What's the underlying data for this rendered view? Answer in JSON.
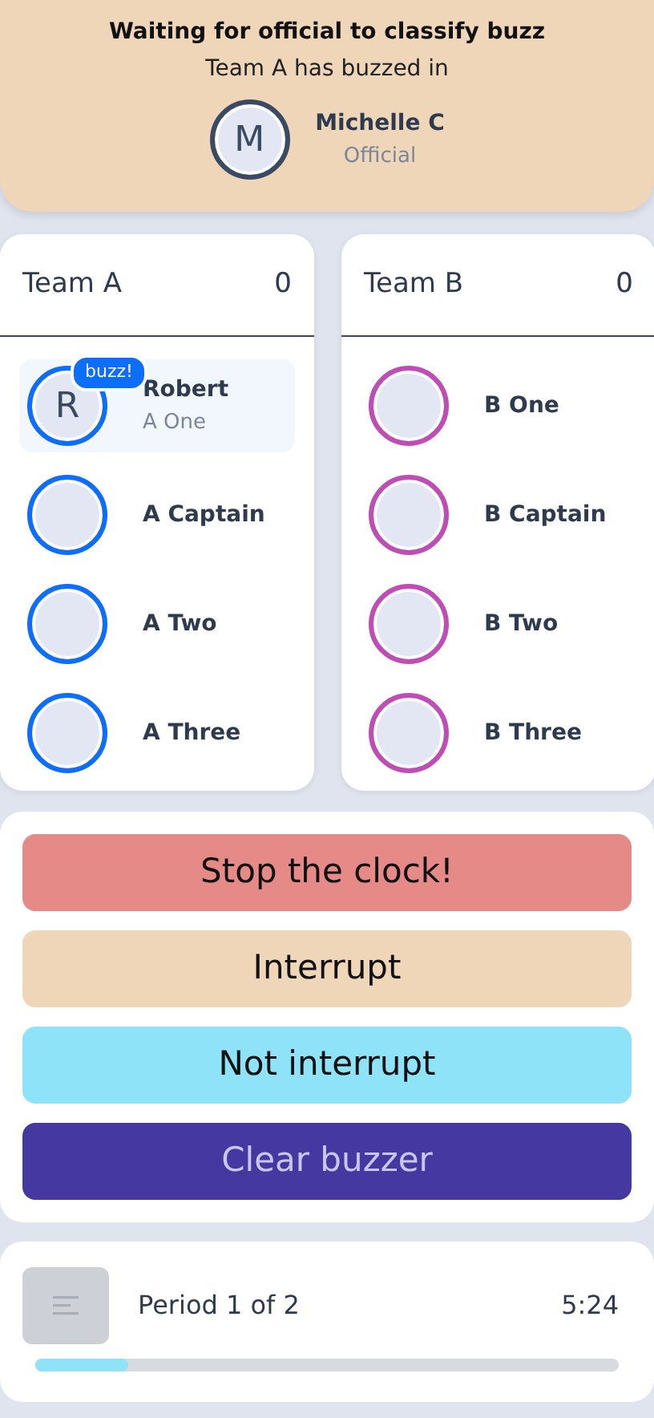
{
  "status": {
    "title": "Waiting for official to classify buzz",
    "message": "Team A has buzzed in",
    "official": {
      "initial": "M",
      "name": "Michelle C",
      "role": "Official"
    }
  },
  "teams": [
    {
      "name": "Team A",
      "score": "0",
      "color": "#0d6efd",
      "players": [
        {
          "initial": "R",
          "name": "Robert",
          "subtitle": "A One",
          "buzzed": true,
          "badge": "buzz!"
        },
        {
          "name": "A Captain",
          "buzzed": false
        },
        {
          "name": "A Two",
          "buzzed": false
        },
        {
          "name": "A Three",
          "buzzed": false
        }
      ]
    },
    {
      "name": "Team B",
      "score": "0",
      "color": "#c04db5",
      "players": [
        {
          "name": "B One",
          "buzzed": false
        },
        {
          "name": "B Captain",
          "buzzed": false
        },
        {
          "name": "B Two",
          "buzzed": false
        },
        {
          "name": "B Three",
          "buzzed": false
        }
      ]
    }
  ],
  "actions": [
    {
      "label": "Stop the clock!",
      "kind": "stop"
    },
    {
      "label": "Interrupt",
      "kind": "interrupt"
    },
    {
      "label": "Not interrupt",
      "kind": "noint"
    },
    {
      "label": "Clear buzzer",
      "kind": "clear"
    }
  ],
  "clock": {
    "period": "Period 1 of 2",
    "time": "5:24",
    "level": 0.16
  }
}
